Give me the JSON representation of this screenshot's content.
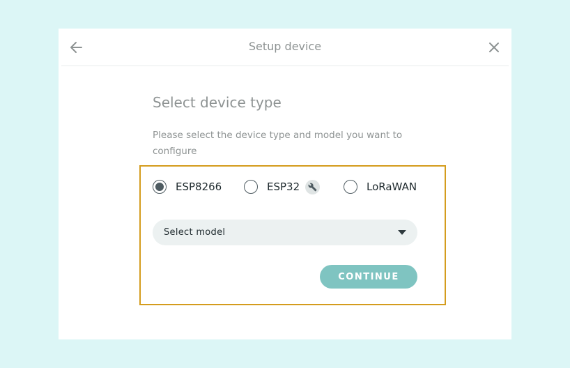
{
  "dialog": {
    "title": "Setup device",
    "back_icon": "arrow-left-icon",
    "close_icon": "close-icon"
  },
  "content": {
    "heading": "Select device type",
    "description": "Please select the device type and model you want to configure"
  },
  "device_types": [
    {
      "label": "ESP8266",
      "selected": true
    },
    {
      "label": "ESP32",
      "selected": false,
      "badge_icon": "wrench-icon"
    },
    {
      "label": "LoRaWAN",
      "selected": false
    }
  ],
  "model_select": {
    "value": "Select model",
    "icon": "caret-down-icon"
  },
  "continue_label": "CONTINUE",
  "colors": {
    "background": "#dcf6f6",
    "accent": "#7fc4c1",
    "highlight_border": "#d49c1d",
    "radio": "#4e5b61"
  }
}
